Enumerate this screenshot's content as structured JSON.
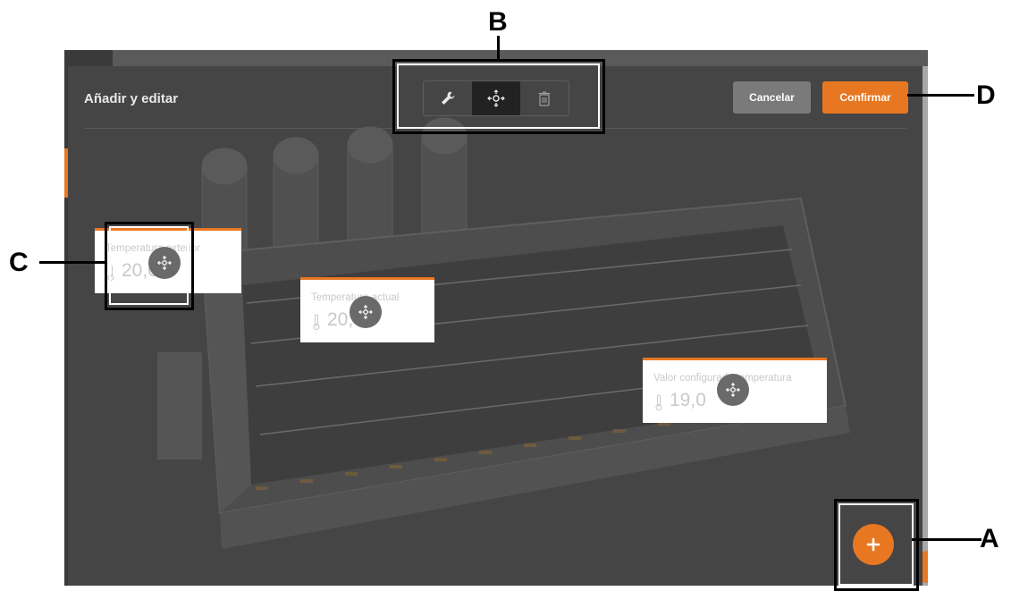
{
  "dialog": {
    "title": "Añadir y editar",
    "cancel_label": "Cancelar",
    "confirm_label": "Confirmar"
  },
  "toolbar": {
    "tools": [
      {
        "icon": "wrench-icon",
        "active": false
      },
      {
        "icon": "move-icon",
        "active": true
      },
      {
        "icon": "trash-icon",
        "active": false
      }
    ]
  },
  "widgets": [
    {
      "label": "Temperatura exterior",
      "value": "20,0",
      "icon": "thermometer-icon"
    },
    {
      "label": "Temperatura actual",
      "value": "20,0",
      "icon": "thermometer-icon"
    },
    {
      "label": "Valor configurado temperatura",
      "value": "19,0",
      "icon": "thermometer-icon"
    }
  ],
  "fab": {
    "icon": "plus-icon"
  },
  "callouts": {
    "a": "A",
    "b": "B",
    "c": "C",
    "d": "D"
  },
  "colors": {
    "accent": "#e87722",
    "overlay": "#454545",
    "cancel": "#7a7a7a"
  }
}
